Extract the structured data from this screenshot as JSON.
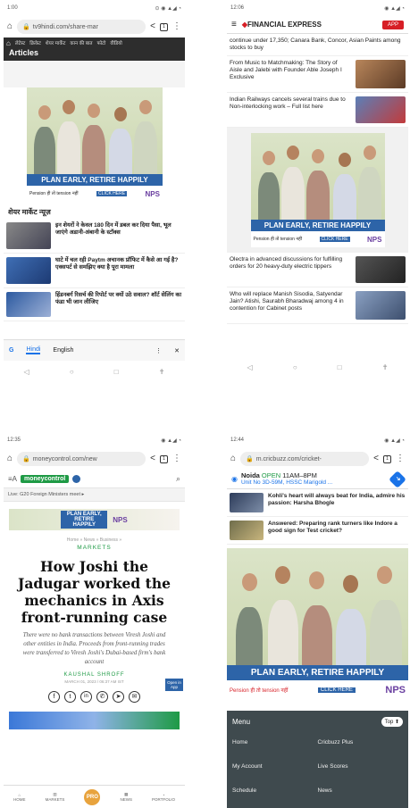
{
  "panel1": {
    "status": {
      "time": "1:00",
      "icons": "⊙ ◉ ▲◢ ◔"
    },
    "url": "tv9hindi.com/share-mar",
    "nav_items": [
      "लेटेस्ट",
      "क्रिकेट",
      "शेयर मार्केट",
      "कान की बात",
      "फोटो",
      "वीडियो"
    ],
    "section_title": "Articles",
    "ad": {
      "plan_text": "PLAN EARLY, RETIRE HAPPILY",
      "badge": "NPS",
      "footer_text": "Pension ही तो tension नहीं",
      "cta": "CLICK HERE"
    },
    "news_heading": "शेयर मार्केट न्यूज़",
    "stories": [
      {
        "text": "इन शेयरों ने केवल 180 दिन में डबल कर दिया पैसा, भूल जाएंगे अडानी-अंबानी के स्टॉक्स"
      },
      {
        "text": "घाटे में चल रही Paytm अचानक प्रॉफिट में कैसे आ गई है? एक्सपर्ट से समझिए क्या है पूरा मामला"
      },
      {
        "text": "हिंडनबर्ग रिसर्च की रिपोर्ट पर क्यों उठे सवाल? शॉर्ट सेलिंग का फंडा भी जान लीजिए"
      }
    ],
    "translate": {
      "hindi": "Hindi",
      "english": "English"
    }
  },
  "panel2": {
    "status": {
      "time": "12:06",
      "icons": "◉ ▲◢ ◔"
    },
    "brand": "FINANCIAL EXPRESS",
    "app_button": "APP",
    "stories_top": [
      {
        "text": "continue under 17,350; Canara Bank, Concor, Asian Paints among stocks to buy"
      },
      {
        "text": "From Music to Matchmaking: The Story of Aisle and Jalebi with Founder Able Joseph I Exclusive"
      },
      {
        "text": "Indian Railways cancels several trains due to Non-interlocking work – Full list here"
      }
    ],
    "ad": {
      "plan_text": "PLAN EARLY, RETIRE HAPPILY",
      "badge": "NPS",
      "footer_text": "Pension ही तो tension नहीं",
      "cta": "CLICK HERE"
    },
    "stories_bottom": [
      {
        "text": "Olectra in advanced discussions for fulfilling orders for 20 heavy-duty electric tippers"
      },
      {
        "text": "Who will replace Manish Sisodia, Satyendar Jain? Atishi, Saurabh Bharadwaj among 4 in contention for Cabinet posts"
      }
    ]
  },
  "panel3": {
    "status": {
      "time": "12:35",
      "icons": "◉ ▲◢ ◔"
    },
    "url": "moneycontrol.com/new",
    "brand": "moneycontrol",
    "ticker": "Live: G20 Foreign Ministers meet ▸",
    "ad": {
      "plan_text": "PLAN EARLY, RETIRE HAPPILY",
      "badge": "NPS"
    },
    "breadcrumb": "Home » News » Business »",
    "section": "MARKETS",
    "headline": "How Joshi the Jadugar worked the mechanics in Axis front-running case",
    "summary": "There were no bank transactions between Viresh Joshi and other entities in India. Proceeds from front-running trades were transferred to Viresh Joshi's Dubai-based firm's bank account",
    "open_app": "Open in App",
    "author": "KAUSHAL SHROFF",
    "date": "MARCH 01, 2023 / 06:37 AM IST",
    "bottom_nav": [
      "HOME",
      "MARKETS",
      "PRO",
      "NEWS",
      "PORTFOLIO"
    ]
  },
  "panel4": {
    "status": {
      "time": "12:44",
      "icons": "◉ ▲◢ ◔"
    },
    "url": "m.cricbuzz.com/cricket-",
    "map_ad": {
      "place": "Noida",
      "open": "OPEN",
      "hours": "11AM–8PM",
      "address": "Unit No 3D-59M, HSSC Marigold ..."
    },
    "stories": [
      {
        "text": "Kohli's heart will always beat for India, admire his passion: Harsha Bhogle"
      },
      {
        "text": "Answered: Preparing rank turners like Indore a good sign for Test cricket?"
      }
    ],
    "ad": {
      "plan_text": "PLAN EARLY, RETIRE HAPPILY",
      "badge": "NPS",
      "footer_text": "Pension ही तो tension नहीं",
      "cta": "CLICK HERE"
    },
    "menu_title": "Menu",
    "top_button": "Top",
    "menu": [
      [
        "Home",
        "Cricbuzz Plus"
      ],
      [
        "My Account",
        "Live Scores"
      ],
      [
        "Schedule",
        "News"
      ]
    ]
  },
  "colors": {
    "fe_red": "#d71f26",
    "mc_green": "#1e9a45",
    "cb_dark": "#3f4a4e",
    "ad_blue": "#2d64a8"
  }
}
